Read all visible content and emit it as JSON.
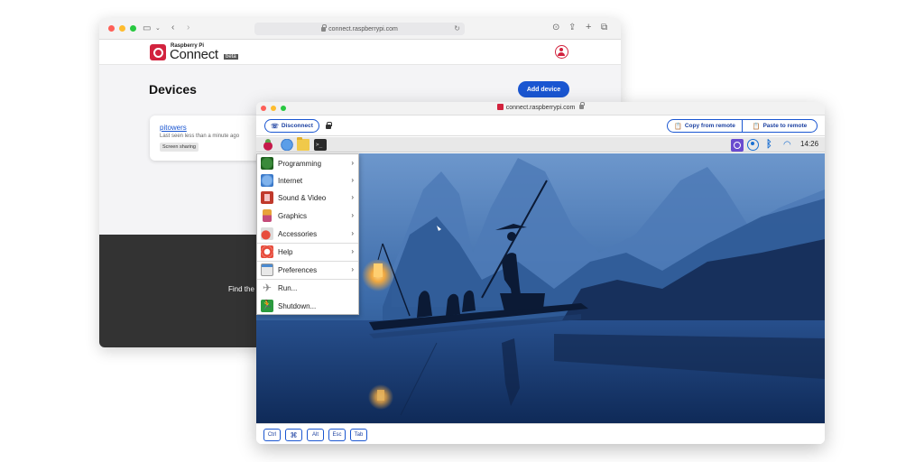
{
  "back_window": {
    "url": "connect.raspberrypi.com",
    "logo_small": "Raspberry Pi",
    "logo_big": "Connect",
    "logo_tag": "beta",
    "page_title": "Devices",
    "add_device_label": "Add device",
    "device": {
      "name": "pitowers",
      "last_seen": "Last seen less than a minute ago",
      "badge": "Screen sharing"
    },
    "footer_text": "Find the"
  },
  "front_window": {
    "url": "connect.raspberrypi.com",
    "disconnect_label": "Disconnect",
    "copy_label": "Copy from remote",
    "paste_label": "Paste to remote",
    "clock": "14:26",
    "terminal_glyph": ">_",
    "menu": [
      {
        "label": "Programming",
        "icon": "programming-icon",
        "submenu": true
      },
      {
        "label": "Internet",
        "icon": "internet-icon",
        "submenu": true
      },
      {
        "label": "Sound & Video",
        "icon": "sound-video-icon",
        "submenu": true
      },
      {
        "label": "Graphics",
        "icon": "graphics-icon",
        "submenu": true
      },
      {
        "label": "Accessories",
        "icon": "accessories-icon",
        "submenu": true
      },
      {
        "label": "Help",
        "icon": "help-icon",
        "submenu": true
      },
      {
        "label": "Preferences",
        "icon": "preferences-icon",
        "submenu": true
      },
      {
        "label": "Run...",
        "icon": "run-icon",
        "submenu": false
      },
      {
        "label": "Shutdown...",
        "icon": "shutdown-icon",
        "submenu": false
      }
    ],
    "keys": [
      "Ctrl",
      "⌘",
      "Alt",
      "Esc",
      "Tab"
    ]
  },
  "colors": {
    "accent": "#1a56d1",
    "brand": "#d2233e",
    "footer_bg": "#333333"
  }
}
